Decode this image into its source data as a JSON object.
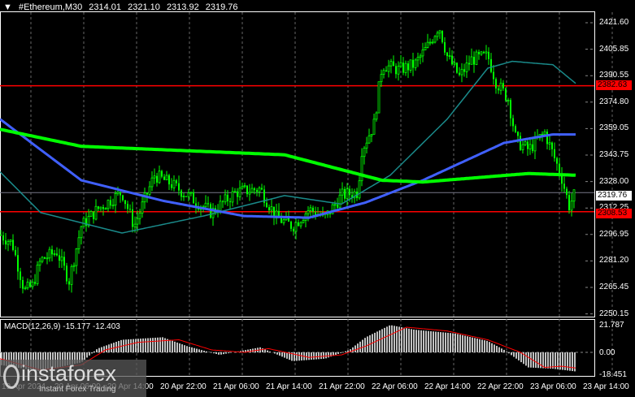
{
  "header": {
    "menu_icon": "triangle-down-icon",
    "symbol": "#Ethereum,M30",
    "open": "2314.01",
    "high": "2321.10",
    "low": "2313.92",
    "close": "2319.76"
  },
  "price_axis": [
    "2421.60",
    "2405.85",
    "2390.55",
    "2374.80",
    "2359.05",
    "2343.75",
    "2328.00",
    "2312.25",
    "2296.95",
    "2281.20",
    "2265.45",
    "2250.15"
  ],
  "current_price": "2319.76",
  "levels": [
    {
      "label": "2382.63",
      "value": 2382.63,
      "color": "#ff0000"
    },
    {
      "label": "2308.53",
      "value": 2308.53,
      "color": "#ff0000"
    }
  ],
  "macd": {
    "label": "MACD(12,26,9) -15.177 -12.403",
    "axis": [
      "21.787",
      "0.00",
      "-18.451"
    ]
  },
  "time_axis": [
    "19 Apr 2024",
    "20 Apr 06:00",
    "20 Apr 14:00",
    "20 Apr 22:00",
    "21 Apr 06:00",
    "21 Apr 14:00",
    "21 Apr 22:00",
    "22 Apr 06:00",
    "22 Apr 14:00",
    "22 Apr 22:00",
    "23 Apr 06:00",
    "23 Apr 14:00"
  ],
  "logo": {
    "brand": "instaforex",
    "tagline": "Instant Forex Trading"
  },
  "chart_data": {
    "type": "candlestick",
    "ylim": [
      2250.15,
      2421.6
    ],
    "price_path": [
      [
        0,
        2295
      ],
      [
        15,
        2290
      ],
      [
        30,
        2262
      ],
      [
        40,
        2265
      ],
      [
        50,
        2280
      ],
      [
        70,
        2285
      ],
      [
        85,
        2268
      ],
      [
        100,
        2300
      ],
      [
        120,
        2310
      ],
      [
        150,
        2320
      ],
      [
        165,
        2300
      ],
      [
        190,
        2330
      ],
      [
        210,
        2325
      ],
      [
        240,
        2315
      ],
      [
        260,
        2308
      ],
      [
        290,
        2320
      ],
      [
        320,
        2322
      ],
      [
        340,
        2305
      ],
      [
        360,
        2300
      ],
      [
        380,
        2310
      ],
      [
        400,
        2305
      ],
      [
        420,
        2318
      ],
      [
        440,
        2320
      ],
      [
        445,
        2345
      ],
      [
        460,
        2360
      ],
      [
        470,
        2395
      ],
      [
        490,
        2392
      ],
      [
        510,
        2395
      ],
      [
        525,
        2405
      ],
      [
        540,
        2418
      ],
      [
        550,
        2400
      ],
      [
        565,
        2388
      ],
      [
        580,
        2398
      ],
      [
        600,
        2400
      ],
      [
        610,
        2385
      ],
      [
        625,
        2375
      ],
      [
        635,
        2350
      ],
      [
        650,
        2345
      ],
      [
        670,
        2355
      ],
      [
        690,
        2330
      ],
      [
        700,
        2312
      ],
      [
        708,
        2320
      ]
    ],
    "ma_slow": [
      [
        0,
        2357
      ],
      [
        100,
        2347
      ],
      [
        200,
        2345
      ],
      [
        350,
        2342
      ],
      [
        470,
        2327
      ],
      [
        520,
        2326
      ],
      [
        650,
        2331
      ],
      [
        708,
        2330
      ]
    ],
    "ma_mid": [
      [
        0,
        2363
      ],
      [
        100,
        2327
      ],
      [
        200,
        2315
      ],
      [
        300,
        2306
      ],
      [
        380,
        2305
      ],
      [
        450,
        2314
      ],
      [
        520,
        2327
      ],
      [
        620,
        2349
      ],
      [
        680,
        2354
      ],
      [
        708,
        2354
      ]
    ],
    "ma_fast": [
      [
        0,
        2332
      ],
      [
        50,
        2308
      ],
      [
        150,
        2296
      ],
      [
        250,
        2306
      ],
      [
        350,
        2318
      ],
      [
        420,
        2313
      ],
      [
        480,
        2330
      ],
      [
        550,
        2363
      ],
      [
        600,
        2393
      ],
      [
        630,
        2397
      ],
      [
        680,
        2395
      ],
      [
        708,
        2384
      ]
    ],
    "macd_hist": [
      [
        0,
        -10
      ],
      [
        50,
        -15
      ],
      [
        100,
        -8
      ],
      [
        120,
        3
      ],
      [
        150,
        10
      ],
      [
        200,
        12
      ],
      [
        230,
        5
      ],
      [
        270,
        -2
      ],
      [
        320,
        4
      ],
      [
        360,
        -7
      ],
      [
        400,
        -5
      ],
      [
        430,
        2
      ],
      [
        450,
        12
      ],
      [
        480,
        21.7
      ],
      [
        510,
        18
      ],
      [
        560,
        15
      ],
      [
        600,
        9
      ],
      [
        620,
        2
      ],
      [
        650,
        -12
      ],
      [
        680,
        -13
      ],
      [
        708,
        -15.177
      ]
    ],
    "macd_signal": [
      [
        0,
        -5
      ],
      [
        50,
        -14
      ],
      [
        100,
        -10
      ],
      [
        130,
        2
      ],
      [
        170,
        8
      ],
      [
        220,
        10
      ],
      [
        260,
        2
      ],
      [
        300,
        0
      ],
      [
        330,
        3
      ],
      [
        380,
        -4
      ],
      [
        420,
        -2
      ],
      [
        450,
        5
      ],
      [
        500,
        20
      ],
      [
        550,
        17
      ],
      [
        600,
        10
      ],
      [
        640,
        0
      ],
      [
        670,
        -12
      ],
      [
        690,
        -11
      ],
      [
        708,
        -12.403
      ]
    ]
  }
}
